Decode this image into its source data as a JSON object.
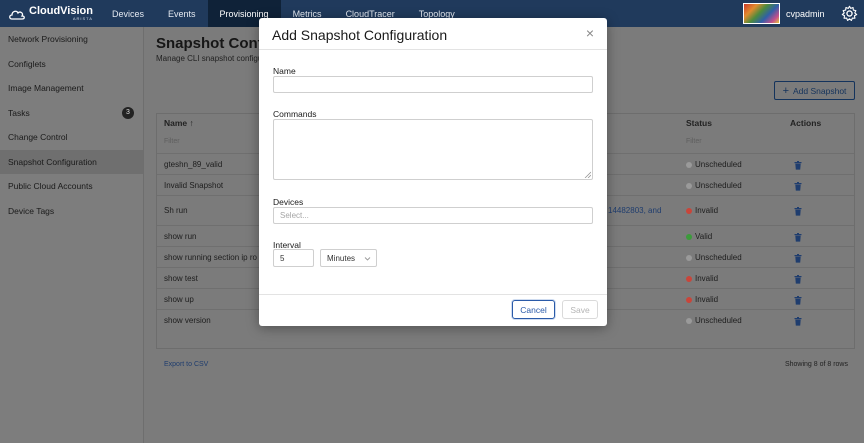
{
  "app": {
    "name": "CloudVision",
    "sub": "ARISTA"
  },
  "nav": {
    "items": [
      {
        "label": "Devices"
      },
      {
        "label": "Events"
      },
      {
        "label": "Provisioning"
      },
      {
        "label": "Metrics"
      },
      {
        "label": "CloudTracer"
      },
      {
        "label": "Topology"
      }
    ],
    "active": "Provisioning",
    "username": "cvpadmin"
  },
  "sidebar": {
    "items": [
      {
        "label": "Network Provisioning"
      },
      {
        "label": "Configlets"
      },
      {
        "label": "Image Management"
      },
      {
        "label": "Tasks",
        "badge": "3"
      },
      {
        "label": "Change Control"
      },
      {
        "label": "Snapshot Configuration"
      },
      {
        "label": "Public Cloud Accounts"
      },
      {
        "label": "Device Tags"
      }
    ],
    "active": "Snapshot Configuration"
  },
  "page": {
    "title": "Snapshot Configu",
    "subtitle": "Manage CLI snapshot configu",
    "add_button": "Add Snapshot"
  },
  "table": {
    "headers": {
      "name": "Name ↑",
      "status": "Status",
      "actions": "Actions"
    },
    "filters": {
      "name": "Filter",
      "status": "Filter"
    },
    "rows": [
      {
        "name": "gteshn_89_valid",
        "status": "Unscheduled",
        "status_color": "#9a9a9a"
      },
      {
        "name": "Invalid Snapshot",
        "status": "Unscheduled",
        "status_color": "#9a9a9a"
      },
      {
        "name": "Sh run",
        "status": "Invalid",
        "status_color": "#c9453a",
        "extra": "14482803, and"
      },
      {
        "name": "show run",
        "status": "Valid",
        "status_color": "#3b9b3a"
      },
      {
        "name": "show running section ip ro",
        "status": "Unscheduled",
        "status_color": "#9a9a9a"
      },
      {
        "name": "show test",
        "status": "Invalid",
        "status_color": "#c9453a"
      },
      {
        "name": "show up",
        "status": "Invalid",
        "status_color": "#c9453a"
      },
      {
        "name": "show version",
        "status": "Unscheduled",
        "status_color": "#9a9a9a"
      }
    ],
    "export_label": "Export to CSV",
    "showing": "Showing 8 of 8 rows"
  },
  "modal": {
    "title": "Add Snapshot Configuration",
    "name_label": "Name",
    "name_value": "",
    "commands_label": "Commands",
    "commands_value": "",
    "devices_label": "Devices",
    "devices_placeholder": "Select...",
    "interval_label": "Interval",
    "interval_value": "5",
    "interval_unit": "Minutes",
    "cancel_label": "Cancel",
    "save_label": "Save"
  },
  "colors": {
    "nav_bg": "#203a5c",
    "accent": "#2a5aa8",
    "invalid": "#c9453a",
    "valid": "#3b9b3a",
    "unscheduled": "#9a9a9a"
  }
}
